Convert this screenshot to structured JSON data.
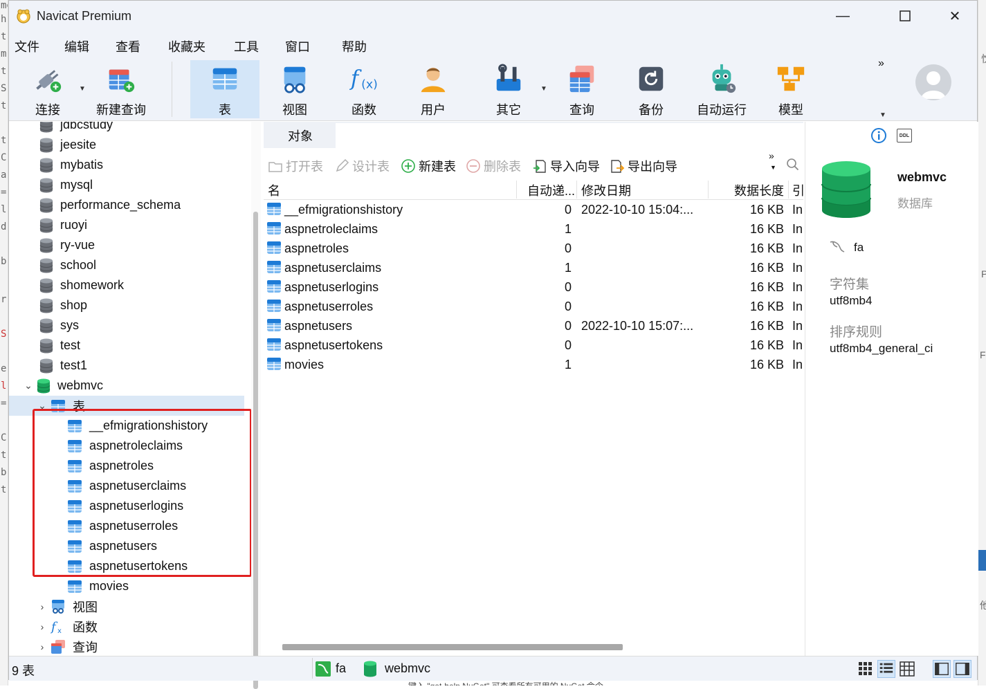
{
  "window": {
    "title": "Navicat Premium"
  },
  "menu": [
    "文件",
    "编辑",
    "查看",
    "收藏夹",
    "工具",
    "窗口",
    "帮助"
  ],
  "toolbar": {
    "connect": "连接",
    "new_query": "新建查询",
    "table": "表",
    "view": "视图",
    "function": "函数",
    "user": "用户",
    "other": "其它",
    "query": "查询",
    "backup": "备份",
    "automation": "自动运行",
    "model": "模型",
    "more": "»"
  },
  "sidebar": {
    "databases": [
      "jdbcstudy",
      "jeesite",
      "mybatis",
      "mysql",
      "performance_schema",
      "ruoyi",
      "ry-vue",
      "school",
      "shomework",
      "shop",
      "sys",
      "test",
      "test1"
    ],
    "open_db": "webmvc",
    "tables_node": "表",
    "tables": [
      "__efmigrationshistory",
      "aspnetroleclaims",
      "aspnetroles",
      "aspnetuserclaims",
      "aspnetuserlogins",
      "aspnetuserroles",
      "aspnetusers",
      "aspnetusertokens",
      "movies"
    ],
    "views_node": "视图",
    "functions_node": "函数",
    "queries_node": "查询"
  },
  "tab": {
    "label": "对象"
  },
  "objbar": {
    "open_table": "打开表",
    "design_table": "设计表",
    "new_table": "新建表",
    "delete_table": "删除表",
    "import_wizard": "导入向导",
    "export_wizard": "导出向导",
    "more": "»"
  },
  "grid": {
    "headers": {
      "name": "名",
      "auto_inc": "自动递...",
      "modified": "修改日期",
      "data_length": "数据长度",
      "engine": "引"
    },
    "rows": [
      {
        "name": "__efmigrationshistory",
        "auto_inc": "0",
        "modified": "2022-10-10 15:04:...",
        "size": "16 KB",
        "engine": "In"
      },
      {
        "name": "aspnetroleclaims",
        "auto_inc": "1",
        "modified": "",
        "size": "16 KB",
        "engine": "In"
      },
      {
        "name": "aspnetroles",
        "auto_inc": "0",
        "modified": "",
        "size": "16 KB",
        "engine": "In"
      },
      {
        "name": "aspnetuserclaims",
        "auto_inc": "1",
        "modified": "",
        "size": "16 KB",
        "engine": "In"
      },
      {
        "name": "aspnetuserlogins",
        "auto_inc": "0",
        "modified": "",
        "size": "16 KB",
        "engine": "In"
      },
      {
        "name": "aspnetuserroles",
        "auto_inc": "0",
        "modified": "",
        "size": "16 KB",
        "engine": "In"
      },
      {
        "name": "aspnetusers",
        "auto_inc": "0",
        "modified": "2022-10-10 15:07:...",
        "size": "16 KB",
        "engine": "In"
      },
      {
        "name": "aspnetusertokens",
        "auto_inc": "0",
        "modified": "",
        "size": "16 KB",
        "engine": "In"
      },
      {
        "name": "movies",
        "auto_inc": "1",
        "modified": "",
        "size": "16 KB",
        "engine": "In"
      }
    ]
  },
  "info": {
    "ddl_label": "DDL",
    "db_name": "webmvc",
    "db_type": "数据库",
    "connection": "fa",
    "charset_label": "字符集",
    "charset": "utf8mb4",
    "collation_label": "排序规则",
    "collation": "utf8mb4_general_ci"
  },
  "status": {
    "count": "9 表",
    "connection": "fa",
    "database": "webmvc"
  },
  "colors": {
    "accent": "#1e7bd6",
    "selected_row": "#dbe8f6",
    "highlight_box": "#e02020",
    "db_green": "#1eaa5a"
  }
}
